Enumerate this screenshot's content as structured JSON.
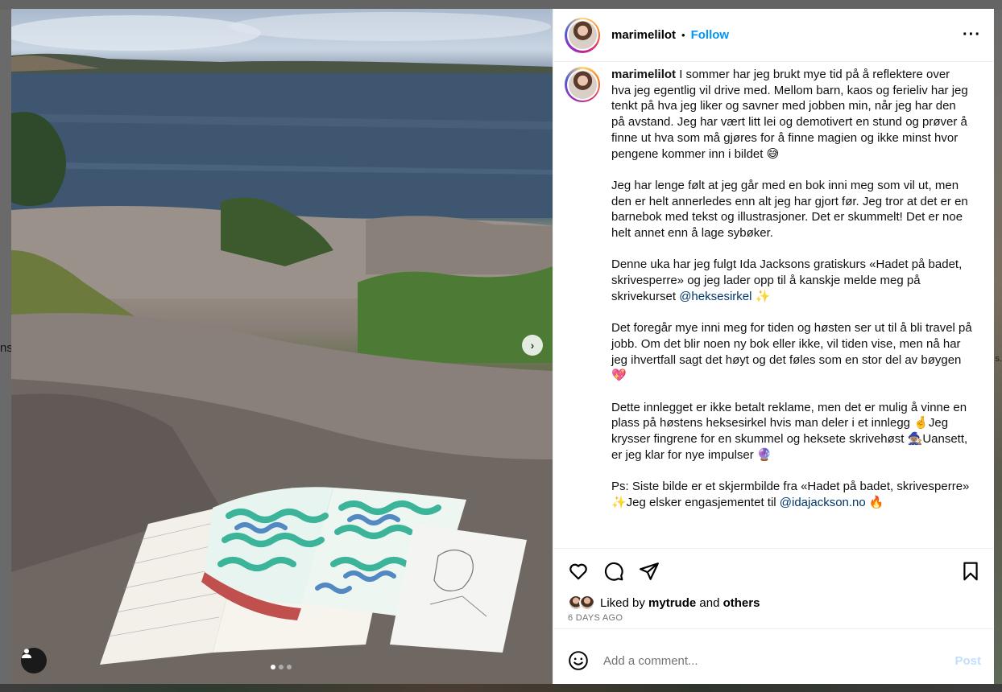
{
  "background": {
    "left_fragment": "ns",
    "right_fragment": "s."
  },
  "post": {
    "username": "marimelilot",
    "separator": "•",
    "follow_label": "Follow",
    "more_icon": "more-horizontal-icon",
    "next_icon": "chevron-right-icon",
    "carousel_count": 3,
    "carousel_active": 0,
    "caption": {
      "author": "marimelilot",
      "p1": "I sommer har jeg brukt mye tid på å reflektere over hva jeg egentlig vil drive med. Mellom barn, kaos og ferieliv har jeg tenkt på hva jeg liker og savner med jobben min, når jeg har den på avstand. Jeg har vært litt lei og demotivert en stund og prøver å finne ut hva som må gjøres for å finne magien og ikke minst hvor pengene kommer inn i bildet 😅",
      "p2": "Jeg har lenge følt at jeg går med en bok inni meg som vil ut, men den er helt annerledes enn alt jeg har gjort før. Jeg tror at det er en barnebok med tekst og illustrasjoner. Det er skummelt! Det er noe helt annet enn å lage sybøker.",
      "p3_before": "Denne uka har jeg fulgt Ida Jacksons gratiskurs «Hadet på badet, skrivesperre» og jeg lader opp til å kanskje melde meg på skrivekurset ",
      "p3_mention": "@heksesirkel",
      "p3_after": " ✨",
      "p4": "Det foregår mye inni meg for tiden og høsten ser ut til å bli travel på jobb. Om det blir noen ny bok eller ikke, vil tiden vise, men nå har jeg ihvertfall sagt det høyt og det føles som en stor del av bøygen 💖",
      "p5": "Dette innlegget er ikke betalt reklame, men det er mulig å vinne en plass på høstens heksesirkel hvis man deler i et innlegg 🤞Jeg krysser fingrene for en skummel og heksete skrivehøst 🧙🏽‍♀️Uansett, er jeg klar for nye impulser 🔮",
      "p6_before": "Ps: Siste bilde er et skjermbilde fra «Hadet på badet, skrivesperre» ✨Jeg elsker engasjementet til ",
      "p6_mention": "@idajackson.no",
      "p6_after": " 🔥"
    },
    "actions": {
      "like_icon": "heart-icon",
      "comment_icon": "comment-icon",
      "share_icon": "send-icon",
      "save_icon": "bookmark-icon"
    },
    "likes": {
      "prefix": "Liked by",
      "user": "mytrude",
      "and": "and",
      "others": "others"
    },
    "time_ago": "6 DAYS AGO",
    "comment": {
      "placeholder": "Add a comment...",
      "post_label": "Post",
      "emoji_icon": "emoji-smile-icon"
    }
  }
}
